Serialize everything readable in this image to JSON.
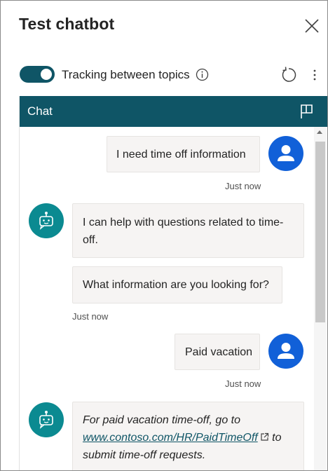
{
  "header": {
    "title": "Test chatbot"
  },
  "controls": {
    "tracking_label": "Tracking between topics",
    "tracking_on": true
  },
  "chat": {
    "title": "Chat",
    "messages": [
      {
        "from": "user",
        "text": "I need time off information",
        "time": "Just now"
      },
      {
        "from": "bot",
        "text": "I can help with questions related to time-off.",
        "line1": "I can help with questions related to time-",
        "line2": "off."
      },
      {
        "from": "bot",
        "text": "What information are you looking for?",
        "time": "Just now"
      },
      {
        "from": "user",
        "text": "Paid vacation",
        "time": "Just now"
      },
      {
        "from": "bot",
        "pre": "For paid vacation time-off, go to",
        "link": "www.contoso.com/HR/PaidTimeOff",
        "post": "to",
        "tail": "submit time-off requests."
      }
    ]
  },
  "colors": {
    "brand": "#0f5566",
    "user_avatar": "#1160d8",
    "bot_avatar": "#0b8a91",
    "bubble": "#f6f4f3"
  },
  "icons": [
    "close-icon",
    "info-icon",
    "refresh-icon",
    "more-icon",
    "flag-icon",
    "user-icon",
    "bot-icon",
    "external-link-icon"
  ]
}
